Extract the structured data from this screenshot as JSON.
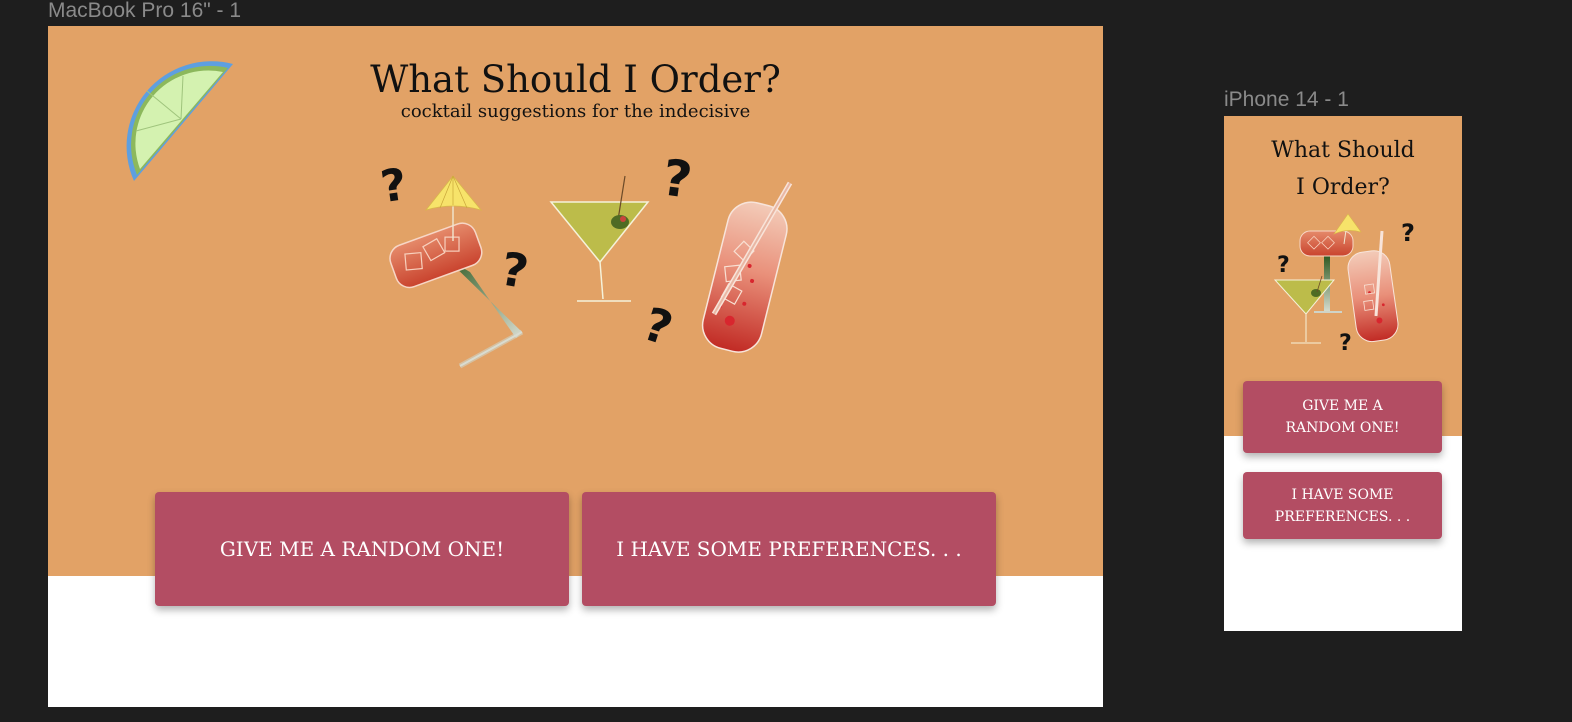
{
  "canvas": {
    "background": "#1e1e1e",
    "label_color": "#8a8a8a"
  },
  "desktop_frame": {
    "label": "MacBook Pro 16\" - 1",
    "title": "What Should I Order?",
    "subtitle": "cocktail suggestions for the indecisive",
    "buttons": {
      "random": "GIVE ME A RANDOM ONE!",
      "preferences": "I HAVE SOME PREFERENCES. . ."
    },
    "question_mark": "?"
  },
  "mobile_frame": {
    "label": "iPhone 14 - 1",
    "title_lines": [
      "What Should",
      "I Order?"
    ],
    "buttons": {
      "random_lines": [
        "GIVE ME A",
        "RANDOM ONE!"
      ],
      "preferences_lines": [
        "I HAVE SOME",
        "PREFERENCES. . ."
      ]
    },
    "question_mark": "?"
  },
  "colors": {
    "hero": "#e2a266",
    "button": "#b34d63",
    "button_text": "#ffffff",
    "lime_flesh": "#d4f2b0",
    "lime_rind": "#4a8fd4",
    "martini": "#bcbc4a",
    "umbrella": "#f7e36a",
    "drink_red": "#d9533c"
  },
  "icons": {
    "lime": "lime-wedge-icon",
    "tilted_drink": "tilted-cocktail-icon",
    "martini": "martini-glass-icon",
    "tall_glass": "tall-glass-icon"
  }
}
